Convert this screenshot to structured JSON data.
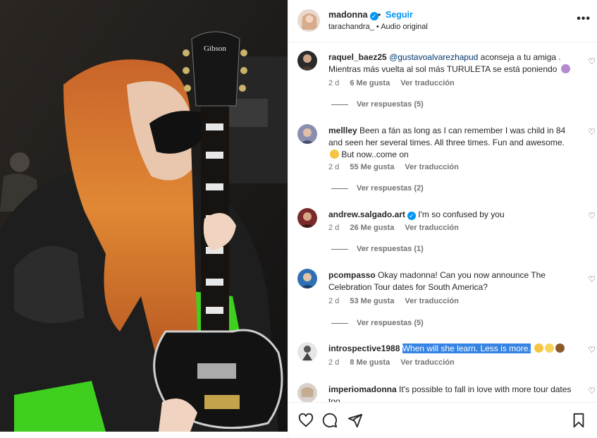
{
  "header": {
    "username": "madonna",
    "verified_icon": "verified-badge-icon",
    "separator": "•",
    "follow_label": "Seguir",
    "audio_user": "tarachandra_",
    "audio_sep": "•",
    "audio_label": "Audio original",
    "more_icon": "more-options-icon"
  },
  "media": {
    "description": "",
    "guitar_brand": "Gibson"
  },
  "comments": [
    {
      "user": "raquel_baez25",
      "mention": "@gustavoalvarezhapud",
      "text": " aconseja a tu amiga . Mientras más vuelta al sol más TURULETA se está poniendo",
      "age": "2 d",
      "likes": "6 Me gusta",
      "translate": "Ver traducción",
      "replies": "Ver respuestas (5)"
    },
    {
      "user": "mellley",
      "text": " Been a fán as long as I can remember I was child in 84 and seen her several times. All three times. Fun and awesome.",
      "text2": " But now..come on",
      "age": "2 d",
      "likes": "55 Me gusta",
      "translate": "Ver traducción",
      "replies": "Ver respuestas (2)"
    },
    {
      "user": "andrew.salgado.art",
      "text": " I'm so confused by you",
      "age": "2 d",
      "likes": "26 Me gusta",
      "translate": "Ver traducción",
      "replies": "Ver respuestas (1)"
    },
    {
      "user": "pcompasso",
      "text": " Okay madonna! Can you now announce The Celebration Tour dates for South America?",
      "age": "2 d",
      "likes": "53 Me gusta",
      "translate": "Ver traducción",
      "replies": "Ver respuestas (5)"
    },
    {
      "user": "introspective1988",
      "text_highlighted": "When will she learn. Less is more.",
      "age": "2 d",
      "likes": "8 Me gusta",
      "translate": "Ver traducción"
    },
    {
      "user": "imperiomadonna",
      "text": " It's possible to fall in love with more tour dates too"
    }
  ],
  "icons": {
    "heart": "heart-icon",
    "comment": "comment-icon",
    "share": "share-icon",
    "save": "bookmark-icon"
  },
  "colors": {
    "accent": "#0095f6",
    "text": "#262626",
    "muted": "#737373",
    "hair": "#d9772a",
    "jacket_green": "#3ecf1f"
  }
}
